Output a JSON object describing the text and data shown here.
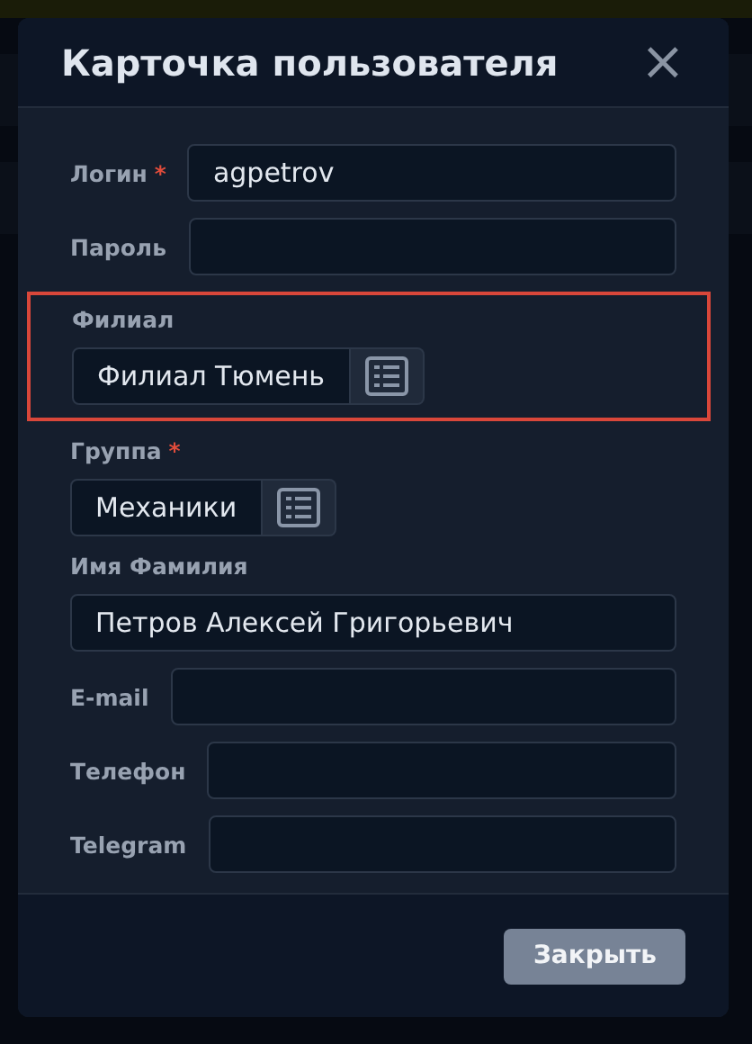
{
  "dialog": {
    "title": "Карточка пользователя",
    "close_icon": "×"
  },
  "fields": [
    {
      "kind": "inline",
      "label": "Логин",
      "required_mark": "*",
      "value": "agpetrov",
      "highlighted": false
    },
    {
      "kind": "inline",
      "label": "Пароль",
      "highlighted": false
    },
    {
      "kind": "picker",
      "label": "Филиал",
      "value": "Филиал Тюмень",
      "highlighted": true
    },
    {
      "kind": "picker",
      "label": "Группа",
      "required_mark": "*",
      "value": "Механики",
      "highlighted": false
    },
    {
      "kind": "stacked",
      "label": "Имя Фамилия",
      "value": "Петров Алексей Григорьевич",
      "highlighted": false
    },
    {
      "kind": "inline",
      "label": "E-mail",
      "highlighted": false
    },
    {
      "kind": "inline",
      "label": "Телефон",
      "highlighted": false
    },
    {
      "kind": "inline",
      "label": "Telegram",
      "highlighted": false
    }
  ],
  "buttons": [
    {
      "label": "Закрыть"
    }
  ]
}
